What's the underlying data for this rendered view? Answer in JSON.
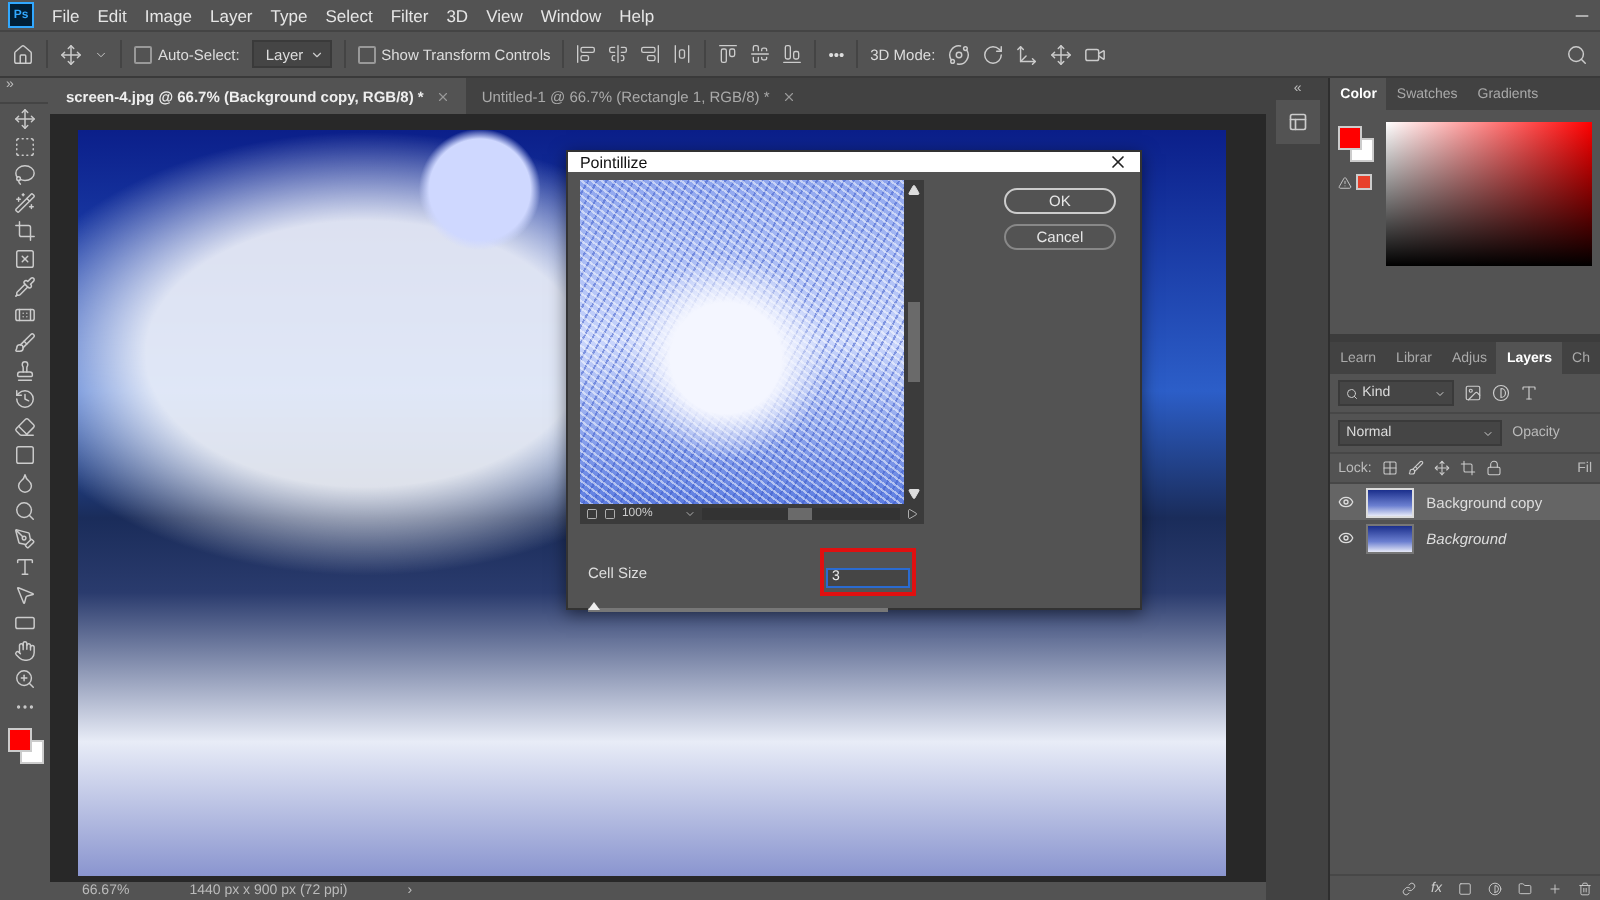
{
  "app": {
    "logo": "Ps"
  },
  "menu": [
    "File",
    "Edit",
    "Image",
    "Layer",
    "Type",
    "Select",
    "Filter",
    "3D",
    "View",
    "Window",
    "Help"
  ],
  "options": {
    "auto_select": {
      "label": "Auto-Select:",
      "checked": false
    },
    "target": "Layer",
    "show_transform": {
      "label": "Show Transform Controls",
      "checked": false
    },
    "more": "•••",
    "mode_label": "3D Mode:"
  },
  "toolbar_collapse": "»",
  "panels_collapse": "«",
  "tabs": [
    {
      "label": "screen-4.jpg @ 66.7% (Background copy, RGB/8) *",
      "selected": true
    },
    {
      "label": "Untitled-1 @ 66.7% (Rectangle 1, RGB/8) *",
      "selected": false
    }
  ],
  "dialog": {
    "title": "Pointillize",
    "zoom": "100%",
    "buttons": [
      "OK",
      "Cancel"
    ],
    "cell_size": {
      "label": "Cell Size",
      "value": "3",
      "level": 0.02
    }
  },
  "color_panel": {
    "tabs": [
      {
        "label": "Color",
        "selected": true
      },
      {
        "label": "Swatches",
        "selected": false
      },
      {
        "label": "Gradients",
        "selected": false
      }
    ]
  },
  "layers_panel": {
    "tabs": [
      {
        "label": "Learn",
        "selected": false
      },
      {
        "label": "Librar",
        "selected": false
      },
      {
        "label": "Adjus",
        "selected": false
      },
      {
        "label": "Layers",
        "selected": true
      },
      {
        "label": "Ch",
        "selected": false
      }
    ],
    "filter": "Kind",
    "blend_mode": "Normal",
    "opacity_label": "Opacity",
    "lock_label": "Lock:",
    "fill_label": "Fil",
    "layers": [
      {
        "name": "Background copy",
        "selected": true,
        "visible": true,
        "locked": false
      },
      {
        "name": "Background",
        "selected": false,
        "visible": true,
        "locked": true
      }
    ],
    "fx": "fx"
  },
  "status": {
    "zoom": "66.67%",
    "size": "1440 px x 900 px (72 ppi)",
    "arrow": "›"
  }
}
